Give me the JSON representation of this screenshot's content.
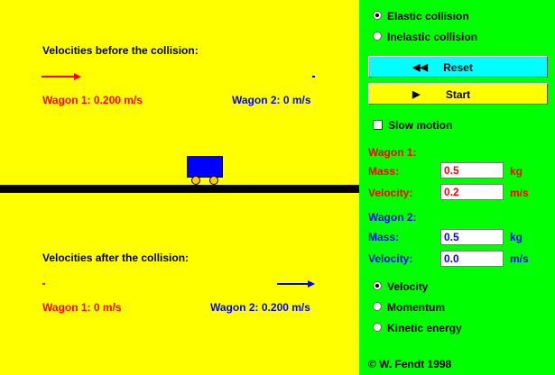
{
  "simulation": {
    "before_title": "Velocities before the collision:",
    "after_title": "Velocities after the collision:",
    "before_wagon1": "Wagon 1:  0.200 m/s",
    "before_wagon2": "Wagon 2:  0 m/s",
    "after_wagon1": "Wagon 1:  0 m/s",
    "after_wagon2": "Wagon 2:  0.200 m/s"
  },
  "controls": {
    "collision_type": {
      "elastic_label": "Elastic collision",
      "inelastic_label": "Inelastic collision",
      "selected": "elastic"
    },
    "reset_label": "Reset",
    "start_label": "Start",
    "slow_motion_label": "Slow motion",
    "slow_motion_checked": false,
    "wagon1": {
      "header": "Wagon 1:",
      "mass_label": "Mass:",
      "mass_value": "0.5",
      "mass_unit": "kg",
      "velocity_label": "Velocity:",
      "velocity_value": "0.2",
      "velocity_unit": "m/s"
    },
    "wagon2": {
      "header": "Wagon 2:",
      "mass_label": "Mass:",
      "mass_value": "0.5",
      "mass_unit": "kg",
      "velocity_label": "Velocity:",
      "velocity_value": "0.0",
      "velocity_unit": "m/s"
    },
    "display_mode": {
      "velocity_label": "Velocity",
      "momentum_label": "Momentum",
      "energy_label": "Kinetic energy",
      "selected": "velocity"
    },
    "copyright": "©  W. Fendt 1998"
  },
  "colors": {
    "sim_background": "#ffff00",
    "panel_background": "#00ff00",
    "wagon1": "#ff0000",
    "wagon2": "#0000ff",
    "reset_button": "#00ffff",
    "start_button": "#ffff00",
    "wheel": "#ffcc00"
  },
  "icons": {
    "reset": "rewind-icon",
    "start": "play-icon"
  }
}
